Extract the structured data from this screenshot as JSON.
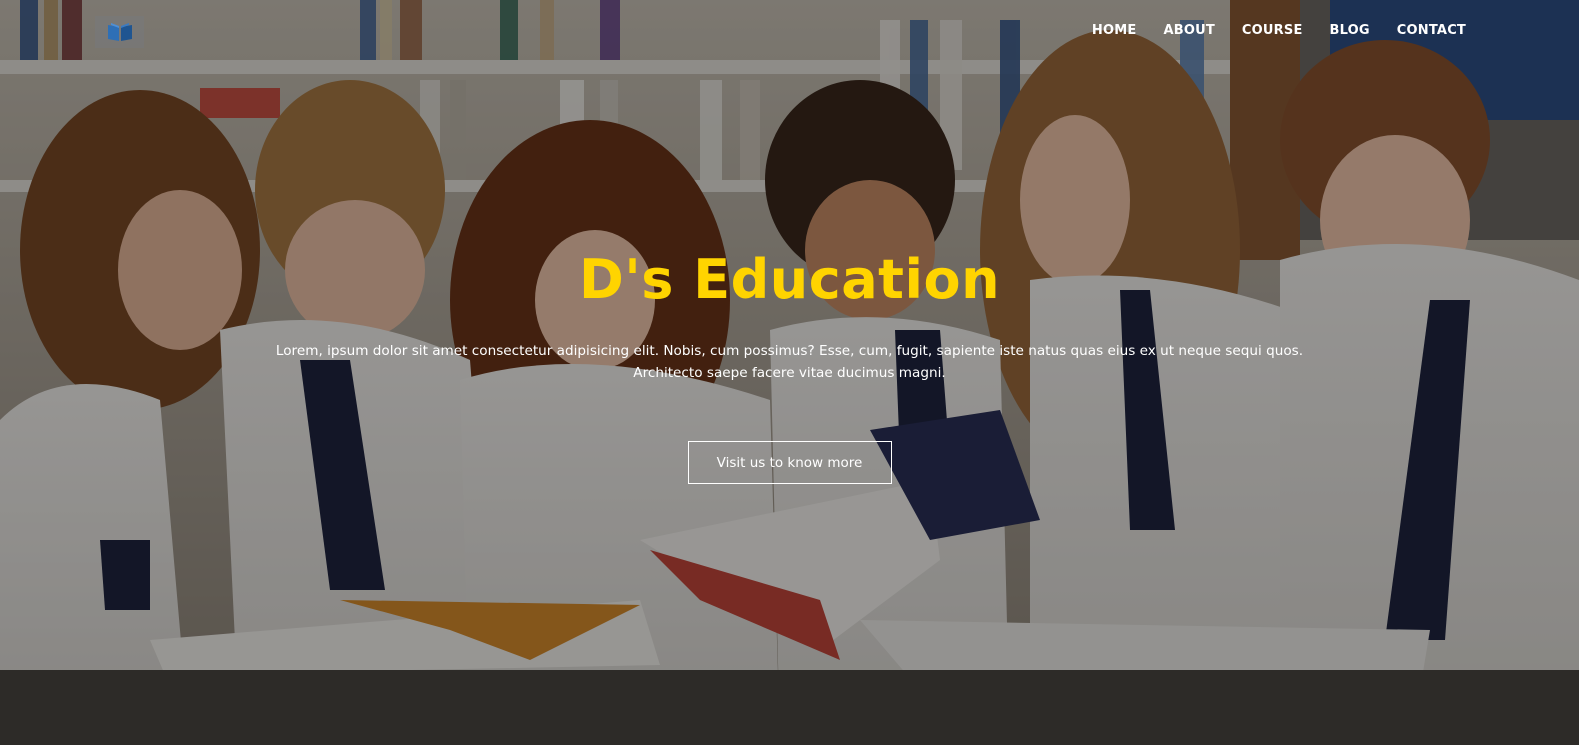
{
  "nav": {
    "logo_icon": "open-book-icon",
    "items": [
      {
        "label": "HOME"
      },
      {
        "label": "ABOUT"
      },
      {
        "label": "COURSE"
      },
      {
        "label": "BLOG"
      },
      {
        "label": "CONTACT"
      }
    ]
  },
  "hero": {
    "title": "D's Education",
    "description": "Lorem, ipsum dolor sit amet consectetur adipisicing elit. Nobis, cum possimus? Esse, cum, fugit, sapiente iste natus quas eius ex ut neque sequi quos. Architecto saepe facere vitae ducimus magni.",
    "cta_label": "Visit us to know more",
    "background_image": "students-reading-books-in-library"
  },
  "colors": {
    "title": "#ffd400",
    "text": "#ffffff",
    "nav_text": "#ffffff"
  }
}
